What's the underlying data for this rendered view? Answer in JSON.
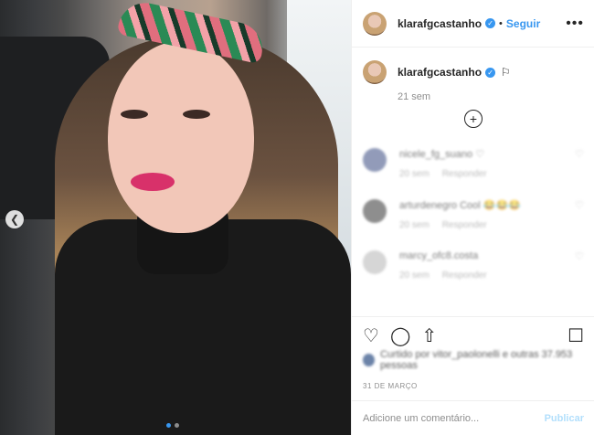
{
  "photo": {
    "dots": 2,
    "active_dot": 0
  },
  "header": {
    "username": "klarafgcastanho",
    "follow_label": "Seguir",
    "more_icon": "more-horizontal-icon"
  },
  "caption": {
    "username": "klarafgcastanho",
    "time": "21 sem"
  },
  "comments": [
    {
      "user": "nicele_fg_suano",
      "text": "♡",
      "time": "20 sem",
      "reply": "Responder"
    },
    {
      "user": "arturdenegro",
      "text": "Cool 😂😂😂",
      "time": "20 sem",
      "reply": "Responder"
    },
    {
      "user": "marcy_ofc8.costa",
      "text": "",
      "time": "20 sem",
      "reply": "Responder"
    }
  ],
  "likes": {
    "text": "Curtido por vitor_paolonelli e outras 37.953 pessoas"
  },
  "date": "31 DE MARÇO",
  "add_comment": {
    "placeholder": "Adicione um comentário...",
    "post_label": "Publicar"
  }
}
